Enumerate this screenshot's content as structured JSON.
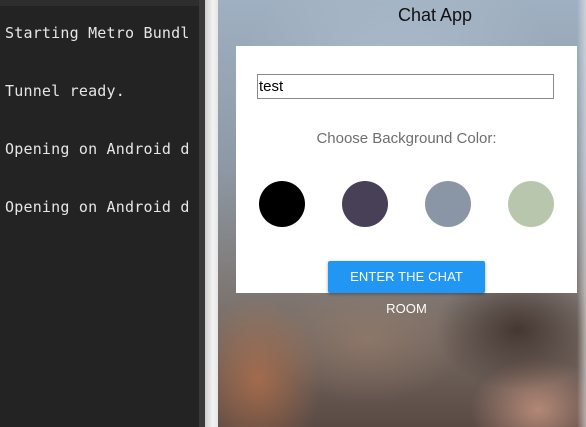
{
  "terminal": {
    "lines": [
      "Starting Metro Bundl",
      "Tunnel ready.",
      "Opening on Android d",
      "Opening on Android d"
    ]
  },
  "app": {
    "title": "Chat App",
    "name_input": {
      "value": "test"
    },
    "color_label": "Choose Background Color:",
    "colors": [
      "#000000",
      "#474056",
      "#8a95a5",
      "#b9c6ae"
    ],
    "enter_button_label": "ENTER THE CHAT ROOM",
    "accent_color": "#2196f3"
  }
}
